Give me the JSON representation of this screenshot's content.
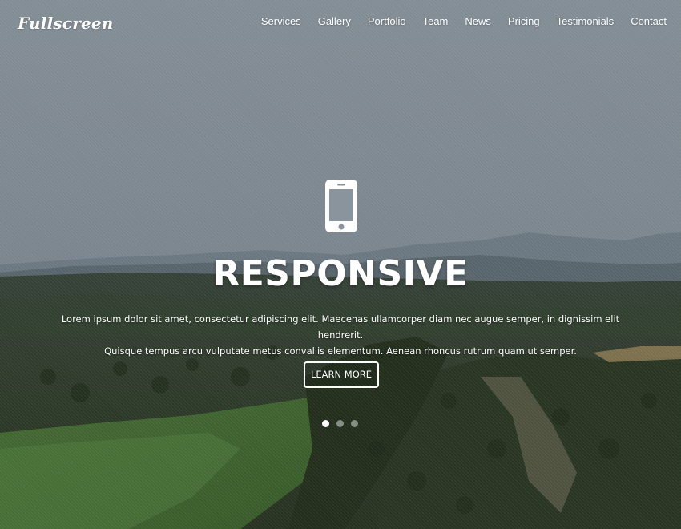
{
  "brand": {
    "logo_text": "Fullscreen"
  },
  "nav": {
    "items": [
      {
        "label": "Services"
      },
      {
        "label": "Gallery"
      },
      {
        "label": "Portfolio"
      },
      {
        "label": "Team"
      },
      {
        "label": "News"
      },
      {
        "label": "Pricing"
      },
      {
        "label": "Testimonials"
      },
      {
        "label": "Contact"
      }
    ]
  },
  "slide": {
    "icon": "smartphone-icon",
    "title": "RESPONSIVE",
    "text_line1": "Lorem ipsum dolor sit amet, consectetur adipiscing elit. Maecenas ullamcorper diam nec augue semper, in dignissim elit hendrerit.",
    "text_line2": "Quisque tempus arcu vulputate metus convallis elementum. Aenean rhoncus rutrum quam ut semper.",
    "button_label": "LEARN MORE"
  },
  "carousel": {
    "total_slides": 3,
    "active_slide": 1
  },
  "colors": {
    "text": "#ffffff",
    "sky": "#8f9aa3",
    "hills": "#3b4a35"
  }
}
